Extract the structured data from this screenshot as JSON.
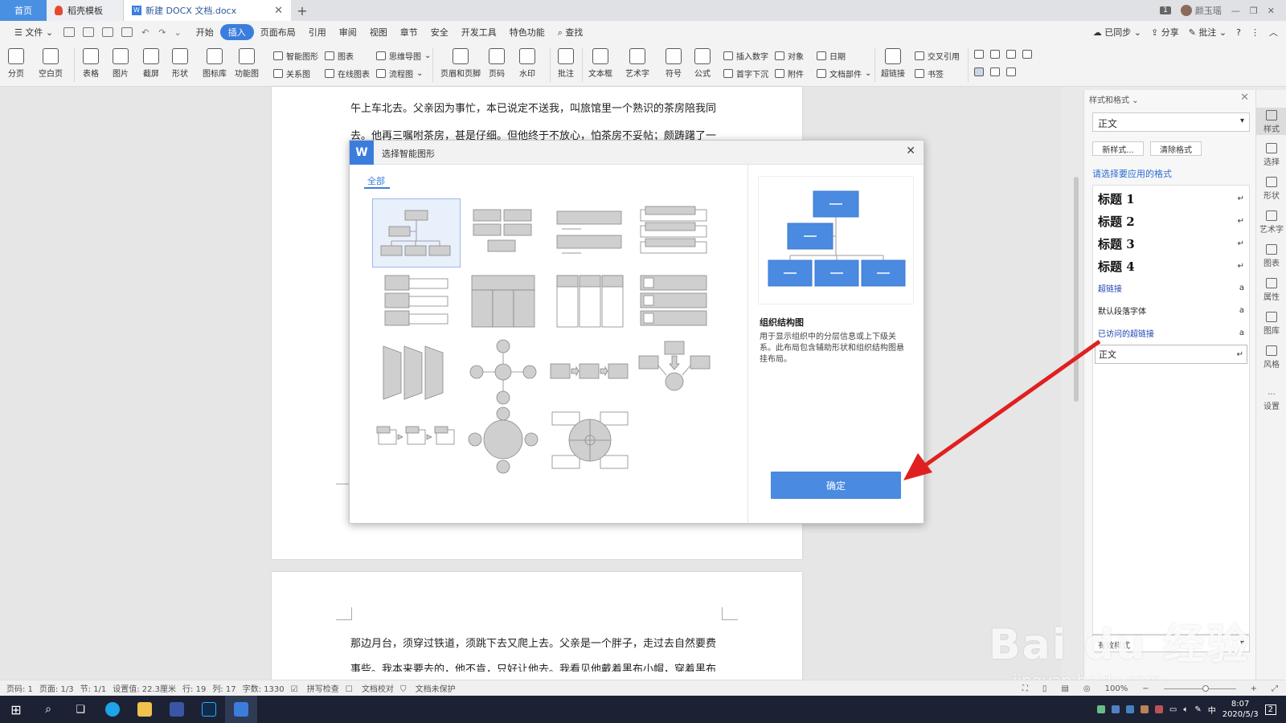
{
  "titlebar": {
    "tabs": [
      {
        "label": "首页"
      },
      {
        "label": "稻壳模板"
      },
      {
        "label": "新建 DOCX 文档.docx"
      }
    ],
    "badge": "1",
    "user": "颜玉瑶"
  },
  "menubar": {
    "file": "文件",
    "items": [
      "开始",
      "插入",
      "页面布局",
      "引用",
      "审阅",
      "视图",
      "章节",
      "安全",
      "开发工具",
      "特色功能"
    ],
    "active": "插入",
    "search": "查找",
    "right": [
      "已同步",
      "分享",
      "批注"
    ]
  },
  "ribbon": {
    "big": [
      "分页",
      "空白页",
      "表格",
      "图片",
      "截屏",
      "形状",
      "图标库",
      "功能图",
      "页眉和页脚",
      "页码",
      "水印",
      "批注",
      "文本框",
      "艺术字",
      "符号",
      "公式",
      "超链接"
    ],
    "small": [
      "智能图形",
      "图表",
      "思维导图",
      "关系图",
      "在线图表",
      "流程图",
      "插入数字",
      "对象",
      "日期",
      "首字下沉",
      "附件",
      "文档部件",
      "交叉引用",
      "书签"
    ]
  },
  "document": {
    "page1_line1": "午上车北去。父亲因为事忙，本已说定不送我，叫旅馆里一个熟识的茶房陪我同",
    "page1_line2": "去。他再三嘱咐茶房，甚是仔细。但他终于不放心，怕茶房不妥帖；颇踌躇了一",
    "page2_line1": "那边月台，须穿过铁道，须跳下去又爬上去。父亲是一个胖子，走过去自然要费",
    "page2_line2": "事些。我本来要去的，他不肯，只好让他去。我看见他戴着黑布小帽，穿着黑布"
  },
  "dialog": {
    "title": "选择智能图形",
    "tab": "全部",
    "preview_name": "组织结构图",
    "preview_desc": "用于显示组织中的分层信息或上下级关系。此布局包含辅助形状和组织结构图悬挂布局。",
    "ok": "确定",
    "selected_index": 0
  },
  "stylepanel": {
    "title": "样式和格式",
    "current": "正文",
    "new_style": "新样式...",
    "clear": "清除格式",
    "hint": "请选择要应用的格式",
    "styles": [
      {
        "name": "标题  1",
        "mark": "↵"
      },
      {
        "name": "标题  2",
        "mark": "↵"
      },
      {
        "name": "标题  3",
        "mark": "↵"
      },
      {
        "name": "标题  4",
        "mark": "↵"
      },
      {
        "name": "超链接",
        "mark": "a"
      },
      {
        "name": "默认段落字体",
        "mark": "a"
      },
      {
        "name": "已访问的超链接",
        "mark": "a"
      },
      {
        "name": "正文",
        "mark": "↵"
      }
    ],
    "bottom": "有效样式"
  },
  "rsidebar": [
    "样式",
    "选择",
    "形状",
    "艺术字",
    "图表",
    "属性",
    "图库",
    "风格",
    "设置"
  ],
  "statusbar": {
    "items": [
      "页码: 1",
      "页面: 1/3",
      "节: 1/1",
      "设置值: 22.3厘米",
      "行: 19",
      "列: 17",
      "字数: 1330",
      "拼写检查",
      "文档校对",
      "文档未保护"
    ],
    "zoom": "100%"
  },
  "taskbar": {
    "ime": "中",
    "time": "8:07",
    "date": "2020/5/3",
    "notif": "2"
  },
  "watermark": {
    "big": "Bai du 经验",
    "small": "jingyan.baidu.com"
  },
  "colors": {
    "accent": "#3b7ddd",
    "ok_button": "#4a8ae0",
    "arrow": "#e02020",
    "preview_box": "#4a8ae0"
  }
}
